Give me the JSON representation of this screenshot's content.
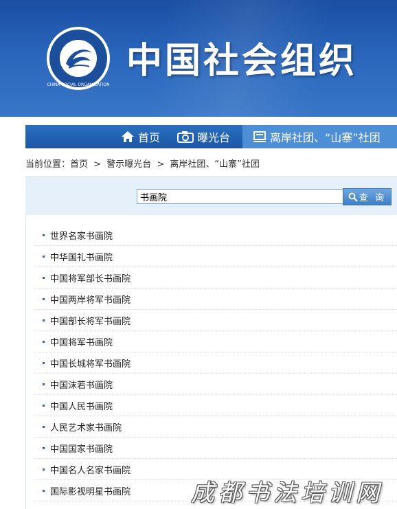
{
  "header": {
    "site_title": "中国社会组织",
    "logo_text_top": "中国社会组织",
    "logo_text_ring": "CHINA SOCIAL ORGANIZATION"
  },
  "nav": {
    "items": [
      {
        "label": "首页",
        "icon": "home-icon"
      },
      {
        "label": "曝光台",
        "icon": "camera-icon"
      },
      {
        "label": "离岸社团、“山寨”社团",
        "icon": "monitor-icon",
        "active": true
      }
    ]
  },
  "breadcrumb": {
    "prefix": "当前位置：",
    "items": [
      "首页",
      "警示曝光台",
      "离岸社团、“山寨”社团"
    ],
    "separator": ">"
  },
  "search": {
    "value": "书画院",
    "button_label": "查 询"
  },
  "results": [
    "世界名家书画院",
    "中华国礼书画院",
    "中国将军部长书画院",
    "中国两岸将军书画院",
    "中国部长将军书画院",
    "中国将军书画院",
    "中国长城将军书画院",
    "中国沫若书画院",
    "中国人民书画院",
    "人民艺术家书画院",
    "中国国家书画院",
    "中国名人名家书画院",
    "国际影视明星书画院"
  ],
  "watermark": "成都书法培训网",
  "colors": {
    "header_blue": "#1a4fa3",
    "nav_blue": "#1b57a6",
    "nav_active": "#4c8fd6",
    "search_panel": "#e5f0fa"
  }
}
